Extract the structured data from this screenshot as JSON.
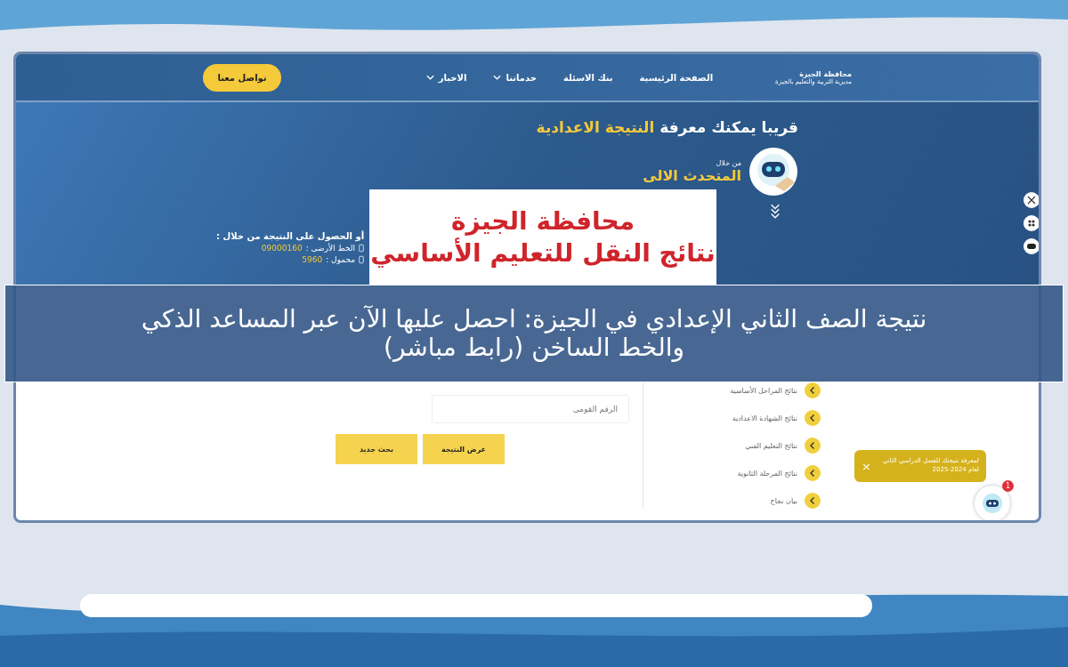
{
  "header": {
    "logo_line1": "محافظة الجيزة",
    "logo_line2": "مديرية التربية والتعليم بالجيزة",
    "nav": [
      {
        "label": "الصفحة الرئيسية",
        "has_menu": false
      },
      {
        "label": "بنك الاسئلة",
        "has_menu": false
      },
      {
        "label": "خدماتنا",
        "has_menu": true
      },
      {
        "label": "الاخبار",
        "has_menu": true
      }
    ],
    "contact_button": "تواصل معنا"
  },
  "hero": {
    "title": "قريبا يمكنك معرفة",
    "title_highlight": "النتيجة الاعدادية",
    "via": "من خلال",
    "bot_name": "المتحدث الالى",
    "alt_title": "أو الحصول على النتيجة من خلال :",
    "phones": [
      {
        "label": "الخط الأرضى :",
        "number": "09000160"
      },
      {
        "label": "محمول :",
        "number": "5960"
      }
    ]
  },
  "title_card": {
    "line1": "محافظة الجيزة",
    "line2": "نتائج النقل للتعليم الأساسي"
  },
  "caption": "نتيجة الصف الثاني الإعدادي في الجيزة: احصل عليها الآن عبر المساعد الذكي والخط الساخن (رابط مباشر)",
  "form": {
    "placeholder": "الرقم القومى",
    "buttons": [
      "عرض النتيجة",
      "بحث جديد"
    ]
  },
  "services": [
    "نتائج المراحل الأساسية",
    "نتائج الشهادة الاعدادية",
    "نتائج التعليم الفني",
    "نتائج المرحلة الثانوية",
    "بيان نجاح"
  ],
  "toast": {
    "text": "لمعرفة نتيجتك للفصل الدراسي الثاني لعام 2024-2025",
    "close": "×"
  },
  "chat": {
    "badge": "1"
  }
}
